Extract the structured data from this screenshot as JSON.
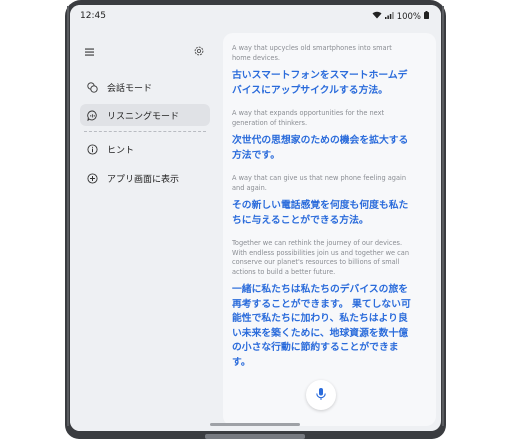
{
  "status_bar": {
    "time": "12:45",
    "battery": "100%"
  },
  "sidebar": {
    "items": [
      {
        "label": "会話モード",
        "icon": "conversation-icon",
        "selected": false
      },
      {
        "label": "リスニングモード",
        "icon": "listening-icon",
        "selected": true
      },
      {
        "label": "ヒント",
        "icon": "info-icon",
        "selected": false
      },
      {
        "label": "アプリ画面に表示",
        "icon": "add-circle-icon",
        "selected": false
      }
    ]
  },
  "transcript": {
    "entries": [
      {
        "source": "A way that upcycles old smartphones into smart home devices.",
        "translation": "古いスマートフォンをスマートホームデバイスにアップサイクルする方法。"
      },
      {
        "source": "A way that expands opportunities for the next generation of thinkers.",
        "translation": "次世代の思想家のための機会を拡大する方法です。"
      },
      {
        "source": "A way that can give us that new phone feeling again and again.",
        "translation": "その新しい電話感覚を何度も何度も私たちに与えることができる方法。"
      },
      {
        "source": "Together we can rethink the journey of our devices. With endless possibilities join us and together we can conserve our planet's resources to billions of small actions to build a better future.",
        "translation": "一緒に私たちは私たちのデバイスの旅を再考することができます。 果てしない可能性で私たちに加わり、私たちはより良い未来を築くために、地球資源を数十億の小さな行動に節約することができます。"
      }
    ]
  },
  "colors": {
    "translation_text": "#2a6bdb",
    "source_text": "#8a8d93",
    "selected_item_bg": "#e0e2e6",
    "mic_icon": "#2a6bdb"
  }
}
